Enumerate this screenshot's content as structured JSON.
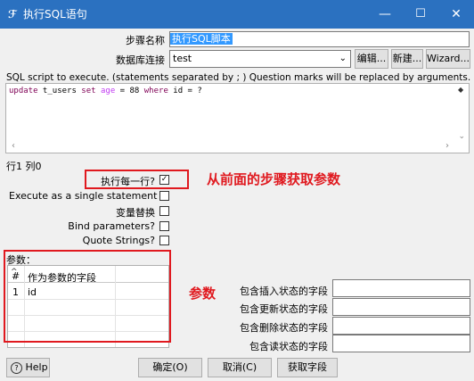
{
  "window": {
    "title": "执行SQL语句",
    "min": "—",
    "max": "☐",
    "close": "✕"
  },
  "form": {
    "step_name_label": "步骤名称",
    "step_name_value": "执行SQL脚本",
    "connection_label": "数据库连接",
    "connection_value": "test",
    "edit_button": "编辑...",
    "new_button": "新建...",
    "wizard_button": "Wizard...",
    "sql_hint": "SQL script to execute. (statements separated by ; ) Question marks will be replaced by arguments.",
    "position": "行1 列0"
  },
  "sql": {
    "kw_update": "update",
    "table": " t_users ",
    "kw_set": "set",
    "col": " age",
    "mid": " = 88 ",
    "kw_where": "where",
    "tail": " id = ?"
  },
  "options": [
    {
      "label": "执行每一行?",
      "checked": true
    },
    {
      "label": "Execute as a single statement",
      "checked": false
    },
    {
      "label": "变量替换",
      "checked": false
    },
    {
      "label": "Bind parameters?",
      "checked": false
    },
    {
      "label": "Quote Strings?",
      "checked": false
    }
  ],
  "params": {
    "label": "参数：",
    "col_num": "#",
    "col_field": "作为参数的字段",
    "rows": [
      {
        "num": "1",
        "field": "id"
      }
    ]
  },
  "status_fields": [
    {
      "label": "包含插入状态的字段",
      "value": ""
    },
    {
      "label": "包含更新状态的字段",
      "value": ""
    },
    {
      "label": "包含删除状态的字段",
      "value": ""
    },
    {
      "label": "包含读状态的字段",
      "value": ""
    }
  ],
  "annotations": {
    "params_from_step": "从前面的步骤获取参数",
    "params": "参数"
  },
  "buttons": {
    "help": "Help",
    "ok": "确定(O)",
    "cancel": "取消(C)",
    "get_fields": "获取字段"
  }
}
